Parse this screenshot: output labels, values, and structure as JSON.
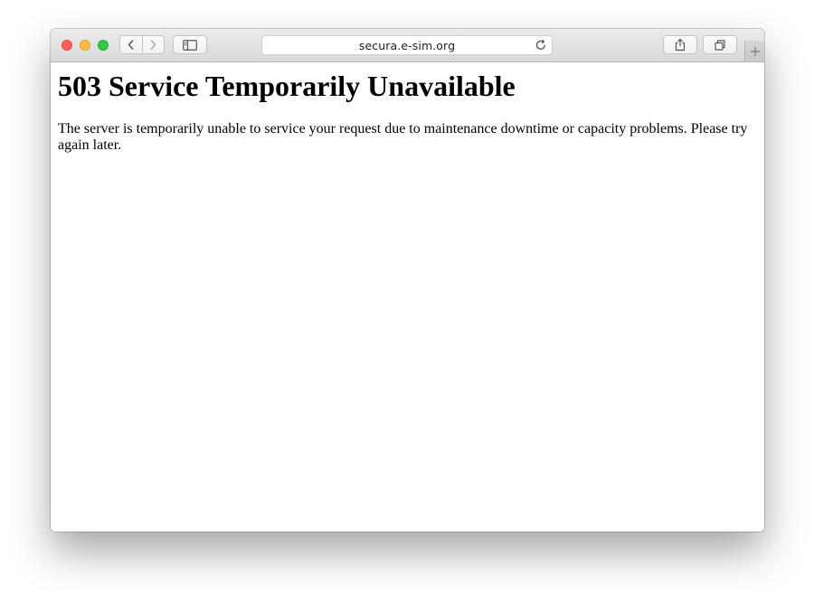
{
  "browser": {
    "url": "secura.e-sim.org",
    "icons": {
      "back": "chevron-left-icon",
      "forward": "chevron-right-icon",
      "sidebar": "sidebar-icon",
      "reload": "reload-icon",
      "share": "share-icon",
      "tabs": "tabs-overview-icon",
      "new_tab": "plus-icon"
    },
    "colors": {
      "close": "#fc605c",
      "minimize": "#fdbc40",
      "maximize": "#34c84a"
    }
  },
  "page": {
    "heading": "503 Service Temporarily Unavailable",
    "message": "The server is temporarily unable to service your request due to maintenance downtime or capacity problems. Please try again later."
  }
}
